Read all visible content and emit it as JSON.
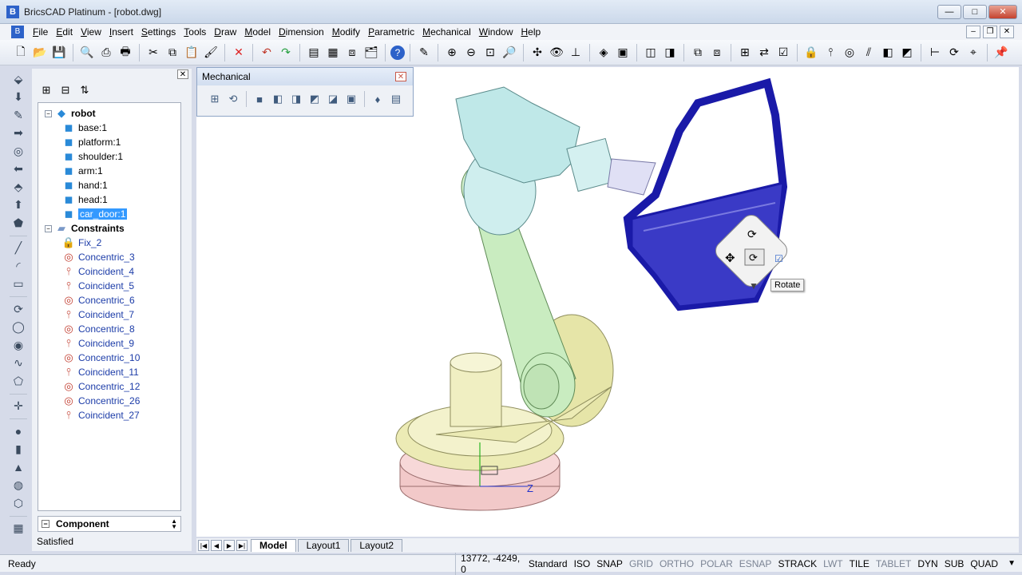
{
  "window": {
    "title": "BricsCAD Platinum - [robot.dwg]",
    "app_icon": "bricscad-logo-icon",
    "minimize": "—",
    "maximize": "□",
    "close": "✕"
  },
  "menubar": {
    "items": [
      "File",
      "Edit",
      "View",
      "Insert",
      "Settings",
      "Tools",
      "Draw",
      "Model",
      "Dimension",
      "Modify",
      "Parametric",
      "Mechanical",
      "Window",
      "Help"
    ]
  },
  "toolbar": {
    "icons": [
      "new-icon",
      "open-icon",
      "save-icon",
      "|",
      "print-preview-icon",
      "print-icon",
      "plot-icon",
      "|",
      "cut-icon",
      "copy-icon",
      "paste-icon",
      "match-properties-icon",
      "|",
      "delete-icon",
      "|",
      "undo-icon",
      "redo-icon",
      "|",
      "properties-icon",
      "design-center-icon",
      "layers-icon",
      "drawing-explorer-icon",
      "|",
      "help-icon",
      "|",
      "edit-icon",
      "|",
      "zoom-in-icon",
      "zoom-out-icon",
      "zoom-window-icon",
      "zoom-realtime-icon",
      "|",
      "orbit-icon",
      "view-icon",
      "ucs-icon",
      "|",
      "3d-view-icon",
      "named-views-icon",
      "|",
      "viewport-icon",
      "layout-icon",
      "|",
      "group-icon",
      "ungroup-icon",
      "|",
      "tree-icon",
      "attach-icon",
      "check-icon",
      "|",
      "lock-icon",
      "coincident-icon",
      "concentric-icon",
      "parallel-icon",
      "cube-icon",
      "box-icon",
      "|",
      "dimension-icon",
      "rotate-icon",
      "measure-icon",
      "|",
      "pin-icon"
    ]
  },
  "left_tools": {
    "icons": [
      "push-icon",
      "down-arrow-icon",
      "edit-face-icon",
      "right-arrow-icon",
      "hole-icon",
      "left-arrow-icon",
      "extrude-icon",
      "up-arrow-icon",
      "shape-icon",
      "|",
      "line-icon",
      "arc-icon",
      "rectangle-icon",
      "|",
      "rotate-icon",
      "circle-icon",
      "donut-icon",
      "spline-icon",
      "polygon-icon",
      "|",
      "point-icon",
      "|",
      "sphere-icon",
      "cylinder-icon",
      "cone-icon",
      "torus-icon",
      "mesh-icon",
      "|",
      "table-icon"
    ]
  },
  "browser": {
    "close": "✕",
    "tree": {
      "root_label": "robot",
      "components": [
        "base:1",
        "platform:1",
        "shoulder:1",
        "arm:1",
        "hand:1",
        "head:1",
        "car_door:1"
      ],
      "selected_component": "car_door:1",
      "constraints_label": "Constraints",
      "constraints": [
        {
          "label": "Fix_2",
          "kind": "fix"
        },
        {
          "label": "Concentric_3",
          "kind": "concentric"
        },
        {
          "label": "Coincident_4",
          "kind": "coincident"
        },
        {
          "label": "Coincident_5",
          "kind": "coincident"
        },
        {
          "label": "Concentric_6",
          "kind": "concentric"
        },
        {
          "label": "Coincident_7",
          "kind": "coincident"
        },
        {
          "label": "Concentric_8",
          "kind": "concentric"
        },
        {
          "label": "Coincident_9",
          "kind": "coincident"
        },
        {
          "label": "Concentric_10",
          "kind": "concentric"
        },
        {
          "label": "Coincident_11",
          "kind": "coincident"
        },
        {
          "label": "Concentric_12",
          "kind": "concentric"
        },
        {
          "label": "Concentric_26",
          "kind": "concentric"
        },
        {
          "label": "Coincident_27",
          "kind": "coincident"
        }
      ]
    },
    "properties": {
      "header": "Component",
      "value": "Satisfied"
    }
  },
  "mechanical_toolbar": {
    "title": "Mechanical",
    "close": "✕"
  },
  "viewport": {
    "tooltip": "Rotate",
    "axis_label": "Z",
    "colors": {
      "door": "#1a1aa8",
      "arm": "#c9ecc0",
      "base": "#ecebb5",
      "head": "#bfe8e8",
      "plate": "#f2c9c9"
    }
  },
  "layout_tabs": {
    "tabs": [
      "Model",
      "Layout1",
      "Layout2"
    ],
    "active": "Model"
  },
  "statusbar": {
    "ready": "Ready",
    "coords": "13772, -4249, 0",
    "items": [
      {
        "label": "Standard",
        "on": true
      },
      {
        "label": "ISO",
        "on": true
      },
      {
        "label": "SNAP",
        "on": true
      },
      {
        "label": "GRID",
        "on": false
      },
      {
        "label": "ORTHO",
        "on": false
      },
      {
        "label": "POLAR",
        "on": false
      },
      {
        "label": "ESNAP",
        "on": false
      },
      {
        "label": "STRACK",
        "on": true
      },
      {
        "label": "LWT",
        "on": false
      },
      {
        "label": "TILE",
        "on": true
      },
      {
        "label": "TABLET",
        "on": false
      },
      {
        "label": "DYN",
        "on": true
      },
      {
        "label": "SUB",
        "on": true
      },
      {
        "label": "QUAD",
        "on": true
      }
    ]
  }
}
